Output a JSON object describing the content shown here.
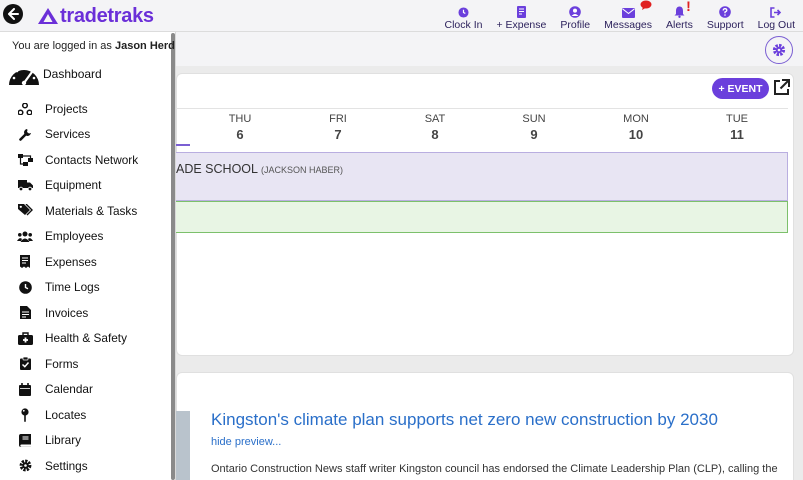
{
  "header": {
    "logo_text": "tradetraks",
    "nav": [
      {
        "label": "Clock In",
        "icon": "clock-icon"
      },
      {
        "label": "+ Expense",
        "icon": "receipt-icon"
      },
      {
        "label": "Profile",
        "icon": "user-icon"
      },
      {
        "label": "Messages",
        "icon": "envelope-icon"
      },
      {
        "label": "Alerts",
        "icon": "bell-icon"
      },
      {
        "label": "Support",
        "icon": "question-icon"
      },
      {
        "label": "Log Out",
        "icon": "logout-icon"
      }
    ],
    "alert_mark": "!"
  },
  "sidebar": {
    "logged_prefix": "You are logged in as",
    "user_name": "Jason Herd",
    "dashboard_label": "Dashboard",
    "items": [
      {
        "label": "Projects",
        "icon": "network-icon"
      },
      {
        "label": "Services",
        "icon": "wrench-icon"
      },
      {
        "label": "Contacts Network",
        "icon": "sitemap-icon"
      },
      {
        "label": "Equipment",
        "icon": "truck-icon"
      },
      {
        "label": "Materials & Tasks",
        "icon": "tags-icon"
      },
      {
        "label": "Employees",
        "icon": "users-icon"
      },
      {
        "label": "Expenses",
        "icon": "receipt-icon"
      },
      {
        "label": "Time Logs",
        "icon": "clock-icon"
      },
      {
        "label": "Invoices",
        "icon": "invoice-icon"
      },
      {
        "label": "Health & Safety",
        "icon": "medkit-icon"
      },
      {
        "label": "Forms",
        "icon": "clipboard-check-icon"
      },
      {
        "label": "Calendar",
        "icon": "calendar-icon"
      },
      {
        "label": "Locates",
        "icon": "map-pin-icon"
      },
      {
        "label": "Library",
        "icon": "book-icon"
      },
      {
        "label": "Settings",
        "icon": "gear-icon"
      }
    ]
  },
  "calendar": {
    "event_button": "+ EVENT",
    "days": [
      {
        "name": "THU",
        "num": "6"
      },
      {
        "name": "FRI",
        "num": "7"
      },
      {
        "name": "SAT",
        "num": "8"
      },
      {
        "name": "SUN",
        "num": "9"
      },
      {
        "name": "MON",
        "num": "10"
      },
      {
        "name": "TUE",
        "num": "11"
      }
    ],
    "event_title": "ADE SCHOOL",
    "event_sub": "(JACKSON HABER)"
  },
  "news": {
    "title": "Kingston's climate plan supports net zero new construction by 2030",
    "hide_preview": "hide preview...",
    "text": "Ontario Construction News staff writer Kingston council has endorsed the Climate Leadership Plan (CLP), calling the"
  }
}
